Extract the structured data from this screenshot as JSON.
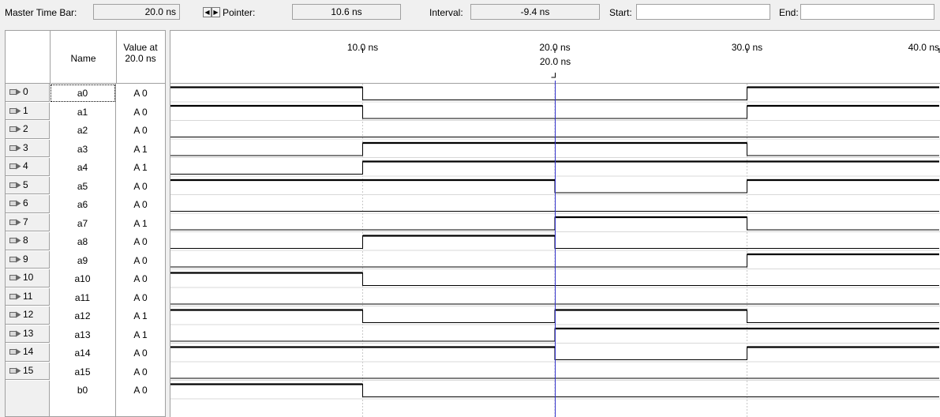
{
  "toolbar": {
    "master_time_bar_label": "Master Time Bar:",
    "master_time_bar_value": "20.0 ns",
    "pointer_label": "Pointer:",
    "pointer_value": "10.6 ns",
    "interval_label": "Interval:",
    "interval_value": "-9.4 ns",
    "start_label": "Start:",
    "start_value": "",
    "end_label": "End:",
    "end_value": "",
    "prev_icon": "arrow-left-icon",
    "next_icon": "arrow-right-icon"
  },
  "columns": {
    "name": "Name",
    "value_line1": "Value at",
    "value_line2": "20.0 ns"
  },
  "timeline": {
    "ticks": [
      {
        "t": 10,
        "label": "10.0 ns"
      },
      {
        "t": 20,
        "label": "20.0 ns"
      },
      {
        "t": 30,
        "label": "30.0 ns"
      },
      {
        "t": 40,
        "label": "40.0 ns"
      }
    ],
    "cursor_label": "20.0 ns",
    "cursor_time": 20,
    "range": [
      0,
      40
    ],
    "cursor_color": "#3333cc"
  },
  "signals": [
    {
      "id": "0",
      "name": "a0",
      "value": "A 0",
      "kind": "input",
      "levels": [
        1,
        0,
        0,
        1
      ]
    },
    {
      "id": "1",
      "name": "a1",
      "value": "A 0",
      "kind": "input",
      "levels": [
        1,
        0,
        0,
        1
      ]
    },
    {
      "id": "2",
      "name": "a2",
      "value": "A 0",
      "kind": "input",
      "levels": [
        0,
        0,
        0,
        0
      ]
    },
    {
      "id": "3",
      "name": "a3",
      "value": "A 1",
      "kind": "input",
      "levels": [
        0,
        1,
        1,
        0
      ]
    },
    {
      "id": "4",
      "name": "a4",
      "value": "A 1",
      "kind": "input",
      "levels": [
        0,
        1,
        1,
        1
      ]
    },
    {
      "id": "5",
      "name": "a5",
      "value": "A 0",
      "kind": "input",
      "levels": [
        1,
        1,
        0,
        1
      ]
    },
    {
      "id": "6",
      "name": "a6",
      "value": "A 0",
      "kind": "input",
      "levels": [
        0,
        0,
        0,
        0
      ]
    },
    {
      "id": "7",
      "name": "a7",
      "value": "A 1",
      "kind": "input",
      "levels": [
        0,
        0,
        1,
        0
      ]
    },
    {
      "id": "8",
      "name": "a8",
      "value": "A 0",
      "kind": "input",
      "levels": [
        0,
        1,
        0,
        0
      ]
    },
    {
      "id": "9",
      "name": "a9",
      "value": "A 0",
      "kind": "input",
      "levels": [
        0,
        0,
        0,
        1
      ]
    },
    {
      "id": "10",
      "name": "a10",
      "value": "A 0",
      "kind": "input",
      "levels": [
        1,
        0,
        0,
        0
      ]
    },
    {
      "id": "11",
      "name": "a11",
      "value": "A 0",
      "kind": "input",
      "levels": [
        0,
        0,
        0,
        0
      ]
    },
    {
      "id": "12",
      "name": "a12",
      "value": "A 1",
      "kind": "input",
      "levels": [
        1,
        0,
        1,
        0
      ]
    },
    {
      "id": "13",
      "name": "a13",
      "value": "A 1",
      "kind": "input",
      "levels": [
        0,
        0,
        1,
        1
      ]
    },
    {
      "id": "14",
      "name": "a14",
      "value": "A 0",
      "kind": "input",
      "levels": [
        1,
        1,
        0,
        1
      ]
    },
    {
      "id": "15",
      "name": "a15",
      "value": "A 0",
      "kind": "input",
      "levels": [
        0,
        0,
        0,
        0
      ]
    },
    {
      "id": "16",
      "name": "b0",
      "value": "A 0",
      "kind": "output",
      "levels": [
        1,
        0,
        0,
        0
      ]
    }
  ]
}
